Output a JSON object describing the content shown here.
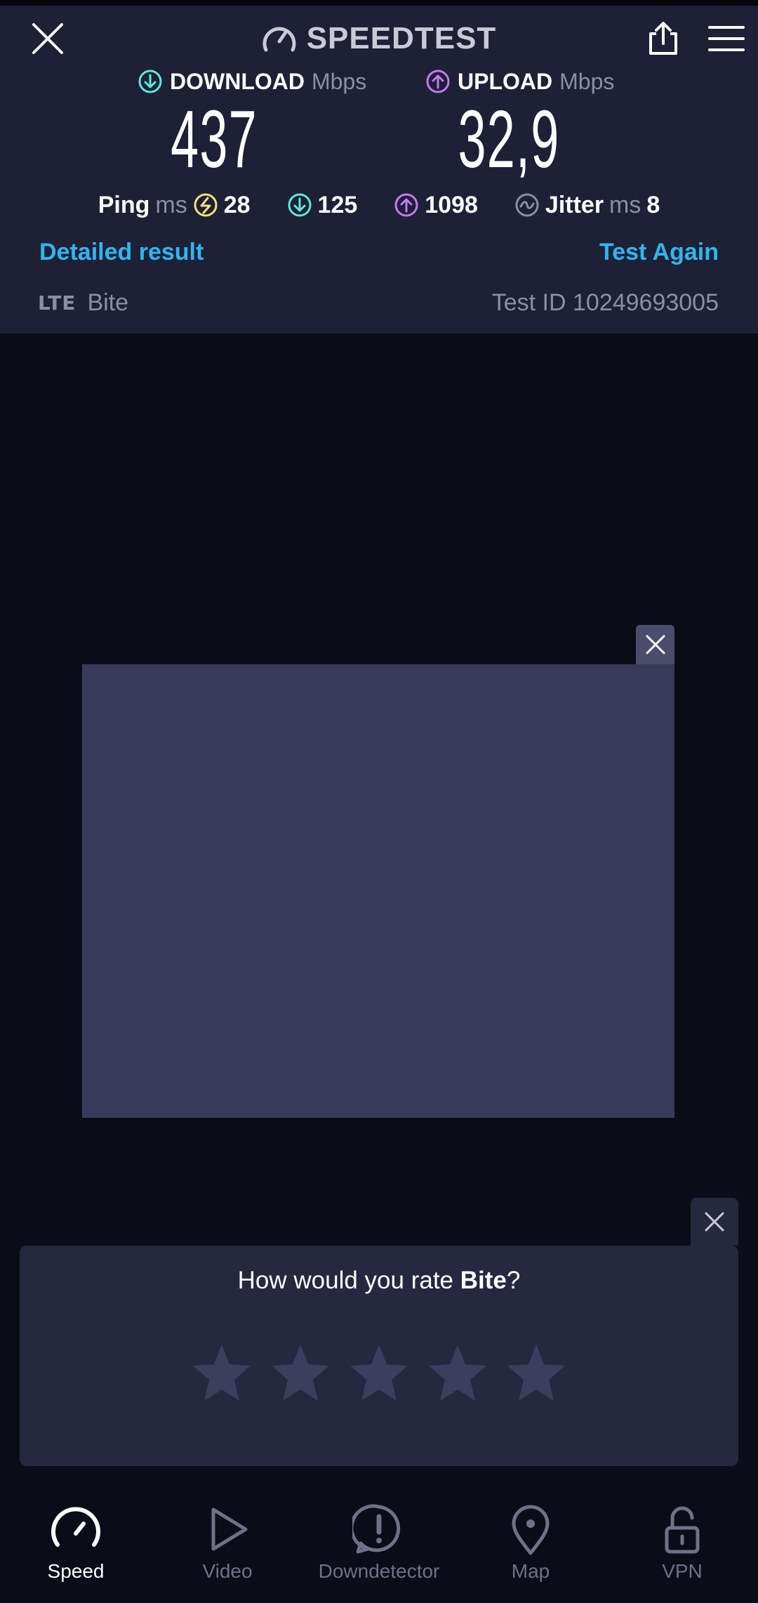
{
  "app": {
    "title": "SPEEDTEST"
  },
  "results": {
    "download": {
      "label": "DOWNLOAD",
      "unit": "Mbps",
      "value": "437"
    },
    "upload": {
      "label": "UPLOAD",
      "unit": "Mbps",
      "value": "32,9"
    },
    "ping": {
      "label": "Ping",
      "unit": "ms",
      "idle": "28",
      "download": "125",
      "upload": "1098"
    },
    "jitter": {
      "label": "Jitter",
      "unit": "ms",
      "value": "8"
    }
  },
  "actions": {
    "detailed_result": "Detailed result",
    "test_again": "Test Again"
  },
  "connection": {
    "network_type": "LTE",
    "provider": "Bite",
    "test_id": "Test ID 10249693005"
  },
  "rating": {
    "question_prefix": "How would you rate ",
    "provider": "Bite",
    "question_suffix": "?",
    "stars_total": 5,
    "stars_selected": 0
  },
  "nav": {
    "items": [
      {
        "label": "Speed",
        "icon": "speedometer-icon",
        "active": true
      },
      {
        "label": "Video",
        "icon": "play-icon",
        "active": false
      },
      {
        "label": "Downdetector",
        "icon": "alert-icon",
        "active": false
      },
      {
        "label": "Map",
        "icon": "map-pin-icon",
        "active": false
      },
      {
        "label": "VPN",
        "icon": "unlock-icon",
        "active": false
      }
    ]
  },
  "colors": {
    "header_bg": "#1e2035",
    "page_bg": "#0a0c18",
    "accent_blue": "#2fb6f0",
    "download_cyan": "#5ee8e0",
    "upload_purple": "#c07cf2",
    "ping_yellow": "#f2e27a"
  }
}
